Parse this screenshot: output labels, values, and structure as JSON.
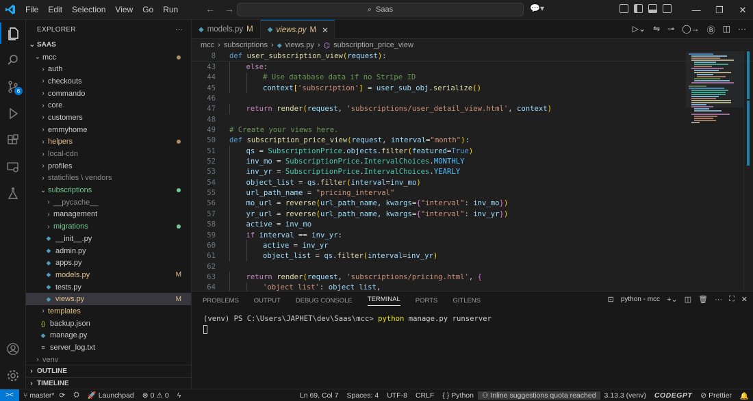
{
  "menu": [
    "File",
    "Edit",
    "Selection",
    "View",
    "Go",
    "Run"
  ],
  "search": "Saas",
  "explorer": {
    "title": "EXPLORER",
    "workspace": "SAAS",
    "tree": [
      {
        "label": "mcc",
        "depth": 0,
        "kind": "folder-open",
        "dot": "#a89060"
      },
      {
        "label": "auth",
        "depth": 1,
        "kind": "folder"
      },
      {
        "label": "checkouts",
        "depth": 1,
        "kind": "folder"
      },
      {
        "label": "commando",
        "depth": 1,
        "kind": "folder"
      },
      {
        "label": "core",
        "depth": 1,
        "kind": "folder"
      },
      {
        "label": "customers",
        "depth": 1,
        "kind": "folder"
      },
      {
        "label": "emmyhome",
        "depth": 1,
        "kind": "folder"
      },
      {
        "label": "helpers",
        "depth": 1,
        "kind": "folder",
        "dot": "#a89060",
        "color": "#e2c08d"
      },
      {
        "label": "local-cdn",
        "depth": 1,
        "kind": "folder",
        "color": "#8c8c8c"
      },
      {
        "label": "profiles",
        "depth": 1,
        "kind": "folder"
      },
      {
        "label": "staticfiles \\ vendors",
        "depth": 1,
        "kind": "folder",
        "color": "#8c8c8c"
      },
      {
        "label": "subscriptions",
        "depth": 1,
        "kind": "folder-open",
        "dot": "#73c991",
        "color": "#73c991"
      },
      {
        "label": "__pycache__",
        "depth": 2,
        "kind": "folder",
        "color": "#8c8c8c"
      },
      {
        "label": "management",
        "depth": 2,
        "kind": "folder"
      },
      {
        "label": "migrations",
        "depth": 2,
        "kind": "folder",
        "dot": "#73c991",
        "color": "#73c991"
      },
      {
        "label": "__init__.py",
        "depth": 2,
        "kind": "py"
      },
      {
        "label": "admin.py",
        "depth": 2,
        "kind": "py"
      },
      {
        "label": "apps.py",
        "depth": 2,
        "kind": "py"
      },
      {
        "label": "models.py",
        "depth": 2,
        "kind": "py",
        "mark": "M",
        "color": "#e2c08d"
      },
      {
        "label": "tests.py",
        "depth": 2,
        "kind": "py"
      },
      {
        "label": "views.py",
        "depth": 2,
        "kind": "py",
        "mark": "M",
        "color": "#e2c08d",
        "selected": true
      },
      {
        "label": "templates",
        "depth": 1,
        "kind": "folder",
        "color": "#e2c08d"
      },
      {
        "label": "backup.json",
        "depth": 1,
        "kind": "json"
      },
      {
        "label": "manage.py",
        "depth": 1,
        "kind": "py"
      },
      {
        "label": "server_log.txt",
        "depth": 1,
        "kind": "txt"
      },
      {
        "label": "venv",
        "depth": 0,
        "kind": "folder",
        "color": "#8c8c8c"
      }
    ],
    "outline": "OUTLINE",
    "timeline": "TIMELINE"
  },
  "tabs": [
    {
      "label": "models.py",
      "mark": "M",
      "active": false
    },
    {
      "label": "views.py",
      "mark": "M",
      "active": true
    }
  ],
  "breadcrumb": [
    "mcc",
    "subscriptions",
    "views.py",
    "subscription_price_view"
  ],
  "code": [
    {
      "n": "8",
      "indent": 0,
      "sticky": true,
      "t": [
        [
          "k",
          "def "
        ],
        [
          "f",
          "user_subscription_view"
        ],
        [
          "b1",
          "("
        ],
        [
          "v",
          "request"
        ],
        [
          "b1",
          ")"
        ],
        [
          "p",
          ":"
        ]
      ]
    },
    {
      "n": "43",
      "indent": 1,
      "t": [
        [
          "kc",
          "else"
        ],
        [
          "p",
          ":"
        ]
      ]
    },
    {
      "n": "44",
      "indent": 2,
      "t": [
        [
          "c",
          "# Use database data if no Stripe ID"
        ]
      ]
    },
    {
      "n": "45",
      "indent": 2,
      "t": [
        [
          "v",
          "context"
        ],
        [
          "b1",
          "["
        ],
        [
          "s",
          "'subscription'"
        ],
        [
          "b1",
          "]"
        ],
        [
          "p",
          " = "
        ],
        [
          "v",
          "user_sub_obj"
        ],
        [
          "p",
          "."
        ],
        [
          "f",
          "serialize"
        ],
        [
          "b1",
          "()"
        ]
      ]
    },
    {
      "n": "46",
      "indent": 0,
      "t": []
    },
    {
      "n": "47",
      "indent": 1,
      "t": [
        [
          "kc",
          "return "
        ],
        [
          "f",
          "render"
        ],
        [
          "b1",
          "("
        ],
        [
          "v",
          "request"
        ],
        [
          "p",
          ", "
        ],
        [
          "s",
          "'subscriptions/user_detail_view.html'"
        ],
        [
          "p",
          ", "
        ],
        [
          "v",
          "context"
        ],
        [
          "b1",
          ")"
        ]
      ]
    },
    {
      "n": "48",
      "indent": 0,
      "t": []
    },
    {
      "n": "49",
      "indent": 0,
      "t": [
        [
          "c",
          "# Create your views here."
        ]
      ]
    },
    {
      "n": "50",
      "indent": 0,
      "t": [
        [
          "k",
          "def "
        ],
        [
          "f",
          "subscription_price_view"
        ],
        [
          "b1",
          "("
        ],
        [
          "v",
          "request"
        ],
        [
          "p",
          ", "
        ],
        [
          "v",
          "interval"
        ],
        [
          "p",
          "="
        ],
        [
          "s",
          "\"month\""
        ],
        [
          "b1",
          ")"
        ],
        [
          "p",
          ":"
        ]
      ]
    },
    {
      "n": "51",
      "indent": 1,
      "t": [
        [
          "v",
          "qs"
        ],
        [
          "p",
          " = "
        ],
        [
          "cl",
          "SubscriptionPrice"
        ],
        [
          "p",
          "."
        ],
        [
          "v",
          "objects"
        ],
        [
          "p",
          "."
        ],
        [
          "f",
          "filter"
        ],
        [
          "b1",
          "("
        ],
        [
          "v",
          "featured"
        ],
        [
          "p",
          "="
        ],
        [
          "k",
          "True"
        ],
        [
          "b1",
          ")"
        ]
      ]
    },
    {
      "n": "52",
      "indent": 1,
      "t": [
        [
          "v",
          "inv_mo"
        ],
        [
          "p",
          " = "
        ],
        [
          "cl",
          "SubscriptionPrice"
        ],
        [
          "p",
          "."
        ],
        [
          "cl",
          "IntervalChoices"
        ],
        [
          "p",
          "."
        ],
        [
          "cn",
          "MONTHLY"
        ]
      ]
    },
    {
      "n": "53",
      "indent": 1,
      "t": [
        [
          "v",
          "inv_yr"
        ],
        [
          "p",
          " = "
        ],
        [
          "cl",
          "SubscriptionPrice"
        ],
        [
          "p",
          "."
        ],
        [
          "cl",
          "IntervalChoices"
        ],
        [
          "p",
          "."
        ],
        [
          "cn",
          "YEARLY"
        ]
      ]
    },
    {
      "n": "54",
      "indent": 1,
      "t": [
        [
          "v",
          "object_list"
        ],
        [
          "p",
          " = "
        ],
        [
          "v",
          "qs"
        ],
        [
          "p",
          "."
        ],
        [
          "f",
          "filter"
        ],
        [
          "b1",
          "("
        ],
        [
          "v",
          "interval"
        ],
        [
          "p",
          "="
        ],
        [
          "v",
          "inv_mo"
        ],
        [
          "b1",
          ")"
        ]
      ]
    },
    {
      "n": "55",
      "indent": 1,
      "t": [
        [
          "v",
          "url_path_name"
        ],
        [
          "p",
          " = "
        ],
        [
          "s",
          "\"pricing_interval\""
        ]
      ]
    },
    {
      "n": "56",
      "indent": 1,
      "t": [
        [
          "v",
          "mo_url"
        ],
        [
          "p",
          " = "
        ],
        [
          "f",
          "reverse"
        ],
        [
          "b1",
          "("
        ],
        [
          "v",
          "url_path_name"
        ],
        [
          "p",
          ", "
        ],
        [
          "v",
          "kwargs"
        ],
        [
          "p",
          "="
        ],
        [
          "b2",
          "{"
        ],
        [
          "s",
          "\"interval\""
        ],
        [
          "p",
          ": "
        ],
        [
          "v",
          "inv_mo"
        ],
        [
          "b2",
          "}"
        ],
        [
          "b1",
          ")"
        ]
      ]
    },
    {
      "n": "57",
      "indent": 1,
      "t": [
        [
          "v",
          "yr_url"
        ],
        [
          "p",
          " = "
        ],
        [
          "f",
          "reverse"
        ],
        [
          "b1",
          "("
        ],
        [
          "v",
          "url_path_name"
        ],
        [
          "p",
          ", "
        ],
        [
          "v",
          "kwargs"
        ],
        [
          "p",
          "="
        ],
        [
          "b2",
          "{"
        ],
        [
          "s",
          "\"interval\""
        ],
        [
          "p",
          ": "
        ],
        [
          "v",
          "inv_yr"
        ],
        [
          "b2",
          "}"
        ],
        [
          "b1",
          ")"
        ]
      ]
    },
    {
      "n": "58",
      "indent": 1,
      "t": [
        [
          "v",
          "active"
        ],
        [
          "p",
          " = "
        ],
        [
          "v",
          "inv_mo"
        ]
      ]
    },
    {
      "n": "59",
      "indent": 1,
      "t": [
        [
          "kc",
          "if "
        ],
        [
          "v",
          "interval"
        ],
        [
          "p",
          " == "
        ],
        [
          "v",
          "inv_yr"
        ],
        [
          "p",
          ":"
        ]
      ]
    },
    {
      "n": "60",
      "indent": 2,
      "t": [
        [
          "v",
          "active"
        ],
        [
          "p",
          " = "
        ],
        [
          "v",
          "inv_yr"
        ]
      ]
    },
    {
      "n": "61",
      "indent": 2,
      "t": [
        [
          "v",
          "object_list"
        ],
        [
          "p",
          " = "
        ],
        [
          "v",
          "qs"
        ],
        [
          "p",
          "."
        ],
        [
          "f",
          "filter"
        ],
        [
          "b1",
          "("
        ],
        [
          "v",
          "interval"
        ],
        [
          "p",
          "="
        ],
        [
          "v",
          "inv_yr"
        ],
        [
          "b1",
          ")"
        ]
      ]
    },
    {
      "n": "62",
      "indent": 0,
      "t": []
    },
    {
      "n": "63",
      "indent": 1,
      "t": [
        [
          "kc",
          "return "
        ],
        [
          "f",
          "render"
        ],
        [
          "b1",
          "("
        ],
        [
          "v",
          "request"
        ],
        [
          "p",
          ", "
        ],
        [
          "s",
          "'subscriptions/pricing.html'"
        ],
        [
          "p",
          ", "
        ],
        [
          "b2",
          "{"
        ]
      ]
    },
    {
      "n": "64",
      "indent": 2,
      "t": [
        [
          "s",
          "'object_list'"
        ],
        [
          "p",
          ": "
        ],
        [
          "v",
          "object_list"
        ],
        [
          "p",
          ","
        ]
      ]
    }
  ],
  "panel": {
    "tabs": [
      "PROBLEMS",
      "OUTPUT",
      "DEBUG CONSOLE",
      "TERMINAL",
      "PORTS",
      "GITLENS"
    ],
    "active": "TERMINAL",
    "shell": "python - mcc",
    "prompt": "(venv) PS C:\\Users\\JAPHET\\dev\\Saas\\mcc> ",
    "command": "python",
    "args": " manage.py runserver"
  },
  "status": {
    "branch": "master*",
    "launchpad": "Launchpad",
    "errors": "0",
    "warnings": "0",
    "position": "Ln 69, Col 7",
    "spaces": "Spaces: 4",
    "encoding": "UTF-8",
    "eol": "CRLF",
    "language": "Python",
    "suggestion": "Inline suggestions quota reached",
    "version": "3.13.3 (venv)",
    "codegpt": "CODEGPT",
    "prettier": "Prettier"
  },
  "colors": {
    "accent": "#0078d4",
    "modified": "#e2c08d",
    "untracked": "#73c991"
  }
}
